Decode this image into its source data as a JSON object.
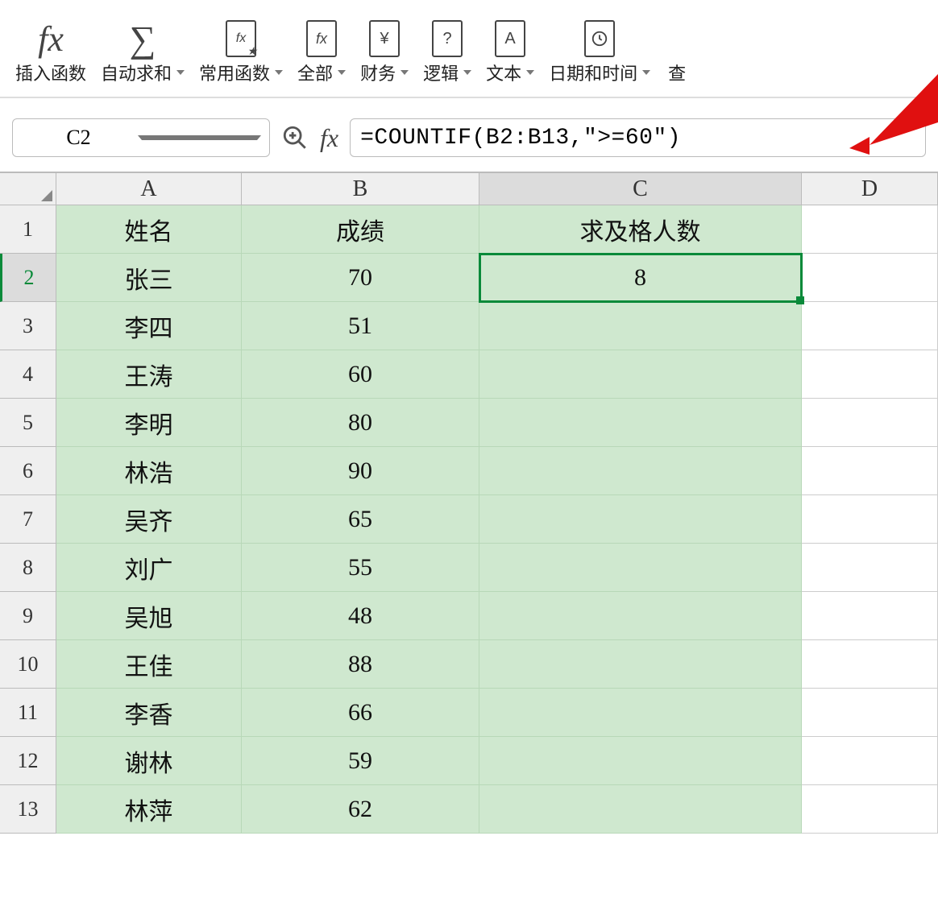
{
  "ribbon": {
    "insert_fn": "插入函数",
    "autosum": "自动求和",
    "common_fn": "常用函数",
    "all": "全部",
    "financial": "财务",
    "logical": "逻辑",
    "text": "文本",
    "datetime": "日期和时间",
    "lookup": "查"
  },
  "namebox": "C2",
  "formula": "=COUNTIF(B2:B13,\">=60\")",
  "columns": [
    "A",
    "B",
    "C",
    "D"
  ],
  "headers": {
    "A": "姓名",
    "B": "成绩",
    "C": "求及格人数"
  },
  "active_cell": "C2",
  "c2_value": "8",
  "rows": [
    {
      "n": 1,
      "A": "姓名",
      "B": "成绩",
      "C": "求及格人数"
    },
    {
      "n": 2,
      "A": "张三",
      "B": "70",
      "C": "8"
    },
    {
      "n": 3,
      "A": "李四",
      "B": "51",
      "C": ""
    },
    {
      "n": 4,
      "A": "王涛",
      "B": "60",
      "C": ""
    },
    {
      "n": 5,
      "A": "李明",
      "B": "80",
      "C": ""
    },
    {
      "n": 6,
      "A": "林浩",
      "B": "90",
      "C": ""
    },
    {
      "n": 7,
      "A": "吴齐",
      "B": "65",
      "C": ""
    },
    {
      "n": 8,
      "A": "刘广",
      "B": "55",
      "C": ""
    },
    {
      "n": 9,
      "A": "吴旭",
      "B": "48",
      "C": ""
    },
    {
      "n": 10,
      "A": "王佳",
      "B": "88",
      "C": ""
    },
    {
      "n": 11,
      "A": "李香",
      "B": "66",
      "C": ""
    },
    {
      "n": 12,
      "A": "谢林",
      "B": "59",
      "C": ""
    },
    {
      "n": 13,
      "A": "林萍",
      "B": "62",
      "C": ""
    }
  ]
}
